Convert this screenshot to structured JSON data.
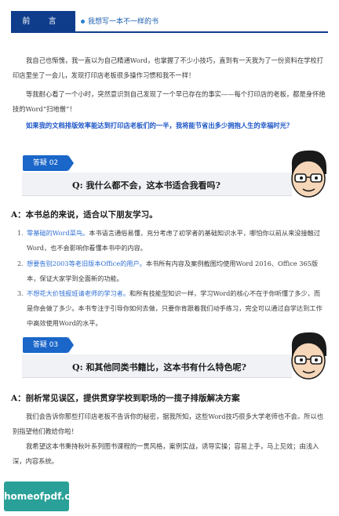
{
  "header": {
    "tab": "前 言",
    "subtitle": "我想写一本不一样的书"
  },
  "intro": {
    "p1": "我自己也惭愧，我一直以为自己精通Word，也掌握了不少小技巧，直到有一天我为了一份资料在学校打印店里坐了一会儿，发现打印店老板很多操作习惯和我不一样！",
    "p2": "等我耐心看了一个小时，突然意识到自己发现了一个早已存在的事实——每个打印店的老板，都是身怀绝技的Word“扫地僧”！",
    "highlight": "如果我的文档排版效率能达到打印店老板们的一半，我将能节省出多少拥抱人生的幸福时光？"
  },
  "qa1": {
    "tag": "答疑 02",
    "question": "Q: 我什么都不会，这本书适合我看吗?",
    "answer": "A：本书总的来说，适合以下朋友学习。",
    "items": [
      {
        "num": "1.",
        "lead": "零基础的Word菜鸟。",
        "text": "本书语言通俗易懂，充分考虑了初学者的基础知识水平，哪怕你以前从来没接触过Word，也不会影响你看懂本书中的内容。"
      },
      {
        "num": "2.",
        "lead": "想要告别2003等老旧版本Office的用户。",
        "text": "本书所有内容及案例截图均使用Word 2016、Office 365版本，保证大家学到全面新的功能。"
      },
      {
        "num": "3.",
        "lead": "不想花大价钱报班请老师的学习者。",
        "text": "和所有技能型知识一样，学习Word的核心不在于你听懂了多少，而是你会做了多少。本书专注于引导你如何去做，只要你肯跟着我们动手练习，完全可以通过自学达到工作中高效使用Word的水平。"
      }
    ]
  },
  "qa2": {
    "tag": "答疑 03",
    "question": "Q: 和其他同类书籍比，这本书有什么特色呢?",
    "answer": "A：剖析常见误区，提供贯穿学校到职场的一揽子排版解决方案",
    "p1": "我们会告诉你那些打印店老板不告诉你的秘密，据我所知，这些Word技巧很多大学老师也不会。所以也别指望他们教给你啦！",
    "p2": "我希望这本书秉持秋叶系列图书课程的一贯风格，案例实战，诱导实操；容易上手，马上见效；由浅入深，内容系统。"
  },
  "watermark": "homeofpdf.com",
  "colors": {
    "brand": "#0f3d8c",
    "accent": "#1a66c9",
    "highlight": "#1d56c7",
    "watermark": "#2aa198"
  }
}
